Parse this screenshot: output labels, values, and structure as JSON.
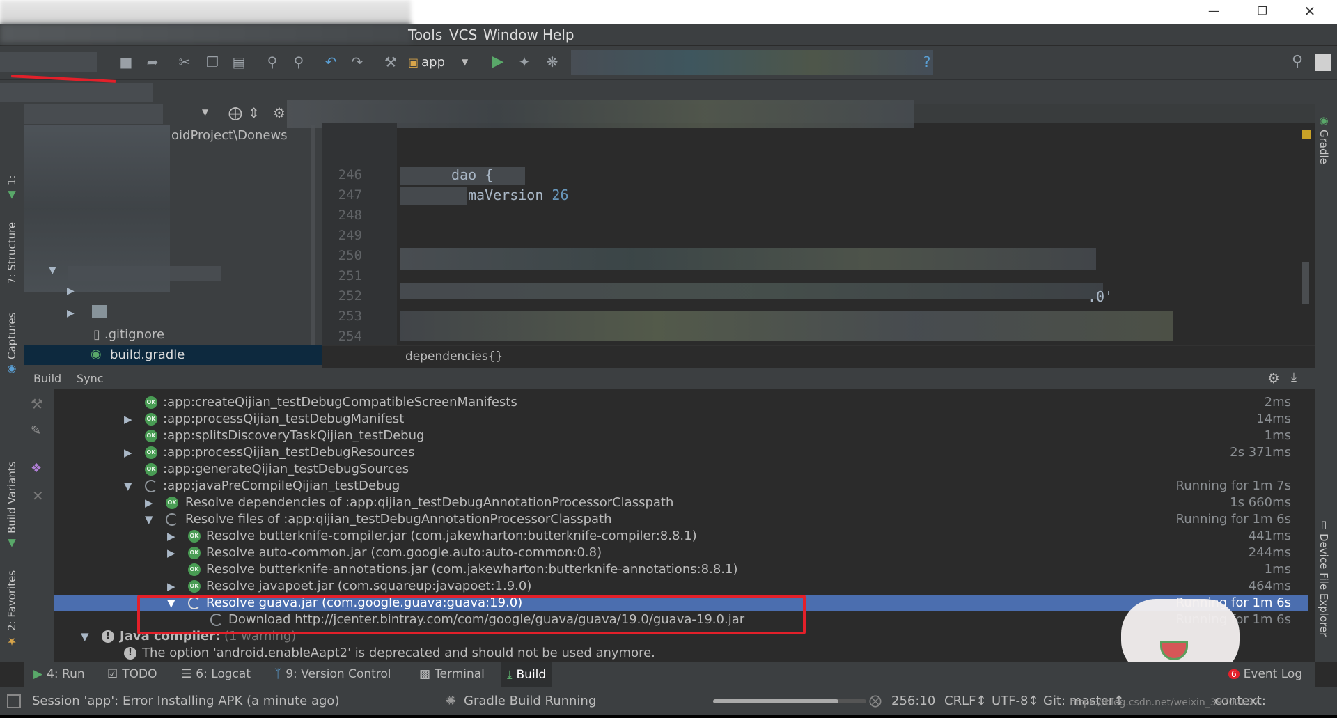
{
  "menubar": {
    "items": [
      "Tools",
      "VCS",
      "Window",
      "Help"
    ]
  },
  "toolbar": {
    "run_config": "app"
  },
  "project_panel": {
    "path_fragment": "oidProject\\Donews",
    "files": [
      ".gitignore",
      "build.gradle"
    ]
  },
  "editor": {
    "lines": [
      {
        "num": "246",
        "text": "dao {"
      },
      {
        "num": "247",
        "text": "maVersion 26"
      },
      {
        "num": "248",
        "text": ""
      },
      {
        "num": "249",
        "text": ""
      },
      {
        "num": "250",
        "text": ""
      },
      {
        "num": "251",
        "text": ""
      },
      {
        "num": "252",
        "text": ".0'"
      },
      {
        "num": "253",
        "text": ""
      },
      {
        "num": "254",
        "text": ""
      }
    ],
    "breadcrumb": "dependencies{}"
  },
  "build_panel": {
    "tabs": [
      "Build",
      "Sync"
    ],
    "rows": [
      {
        "label": ":app:createQijian_testDebugCompatibleScreenManifests",
        "time": "2ms",
        "status": "ok"
      },
      {
        "label": ":app:processQijian_testDebugManifest",
        "time": "14ms",
        "status": "ok"
      },
      {
        "label": ":app:splitsDiscoveryTaskQijian_testDebug",
        "time": "1ms",
        "status": "ok"
      },
      {
        "label": ":app:processQijian_testDebugResources",
        "time": "2s 371ms",
        "status": "ok"
      },
      {
        "label": ":app:generateQijian_testDebugSources",
        "time": "",
        "status": "ok"
      },
      {
        "label": ":app:javaPreCompileQijian_testDebug",
        "time": "Running for 1m 7s",
        "status": "running"
      },
      {
        "label": "Resolve dependencies of :app:qijian_testDebugAnnotationProcessorClasspath",
        "time": "1s 660ms",
        "status": "ok"
      },
      {
        "label": "Resolve files of :app:qijian_testDebugAnnotationProcessorClasspath",
        "time": "Running for 1m 6s",
        "status": "running"
      },
      {
        "label": "Resolve butterknife-compiler.jar (com.jakewharton:butterknife-compiler:8.8.1)",
        "time": "441ms",
        "status": "ok"
      },
      {
        "label": "Resolve auto-common.jar (com.google.auto:auto-common:0.8)",
        "time": "244ms",
        "status": "ok"
      },
      {
        "label": "Resolve butterknife-annotations.jar (com.jakewharton:butterknife-annotations:8.8.1)",
        "time": "1ms",
        "status": "ok"
      },
      {
        "label": "Resolve javapoet.jar (com.squareup:javapoet:1.9.0)",
        "time": "464ms",
        "status": "ok"
      },
      {
        "label": "Resolve guava.jar (com.google.guava:guava:19.0)",
        "time": "Running for 1m 6s",
        "status": "running"
      },
      {
        "label": "Download http://jcenter.bintray.com/com/google/guava/guava/19.0/guava-19.0.jar",
        "time": "Running for 1m 6s",
        "status": "running"
      },
      {
        "label": "Java compiler:",
        "note": "(1 warning)",
        "time": "",
        "status": "warn"
      },
      {
        "label": "The option 'android.enableAapt2' is deprecated and should not be used anymore.",
        "time": "",
        "status": "warn"
      }
    ]
  },
  "left_tools": {
    "project": "1:",
    "structure": "7: Structure",
    "captures": "Captures",
    "build_variants": "Build Variants",
    "favorites": "2: Favorites"
  },
  "right_tools": {
    "gradle": "Gradle",
    "device_explorer": "Device File Explorer"
  },
  "bottom_tabs": {
    "run": "4: Run",
    "todo": "TODO",
    "logcat": "6: Logcat",
    "vcs": "9: Version Control",
    "terminal": "Terminal",
    "build": "Build",
    "event_log": "Event Log",
    "event_count": "6"
  },
  "status": {
    "message": "Session 'app': Error Installing APK (a minute ago)",
    "gradle": "Gradle Build Running",
    "position": "256:10",
    "line_sep": "CRLF↕",
    "encoding": "UTF-8↕",
    "git": "Git: master↕",
    "context": "context:",
    "watermark": "https://blog.csdn.net/weixin_39702657"
  },
  "colors": {
    "accent_blue": "#4b6eaf",
    "ok_green": "#499c54",
    "annotation_red": "#e3202a",
    "bg_dark": "#2b2b2b",
    "panel": "#3c3f41"
  }
}
